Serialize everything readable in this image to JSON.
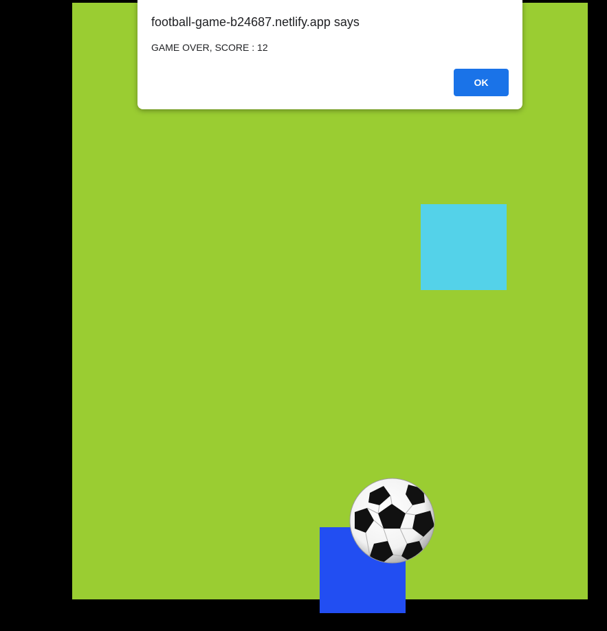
{
  "dialog": {
    "title": "football-game-b24687.netlify.app says",
    "message": "GAME OVER, SCORE : 12",
    "ok_label": "OK"
  },
  "game": {
    "score": 12,
    "field_color": "#9acd32",
    "obstacle_color": "#54d2e9",
    "player_color": "#224ef2",
    "background_color": "#000000",
    "ball_icon": "soccer-ball-icon"
  }
}
